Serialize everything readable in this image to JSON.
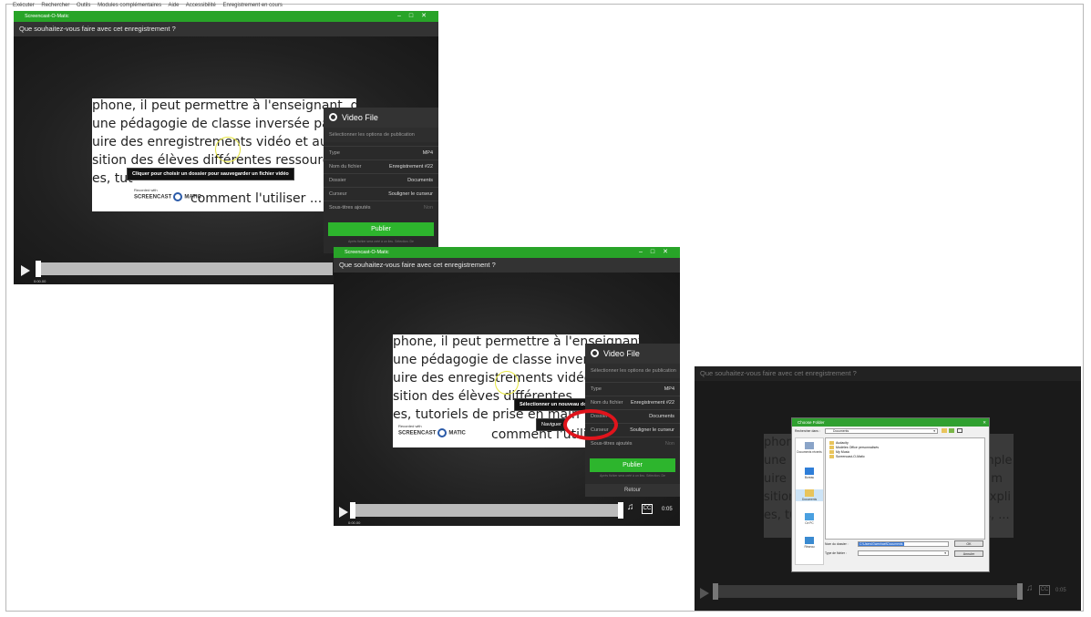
{
  "menubar": [
    "Exécuter",
    "Rechercher",
    "Outils",
    "Modules complémentaires",
    "Aide",
    "Accessibilité",
    "Enregistrement en cours"
  ],
  "window1": {
    "title": "Screencast-O-Matic",
    "question": "Que souhaitez-vous faire avec cet enregistrement ?",
    "slide_lines": [
      "phone, il peut permettre à l'enseignant, dans",
      "une pédagogie de classe inversée par ex",
      "uire des enregistrements vidéo et audi",
      "sition des élèves différentes ressources",
      "es, tut",
      "comment l'utiliser ..."
    ],
    "logo_top": "Recorded with",
    "logo": "SCREENCAST",
    "logo_tail": "MATIC",
    "tooltip": "Cliquer pour choisir un dossier pour sauvegarder un fichier vidéo",
    "panel": {
      "header": "Video File",
      "subtitle": "Sélectionner les options de publication",
      "rows": [
        {
          "label": "Type",
          "value": "MP4"
        },
        {
          "label": "Nom du fichier",
          "value": "Enregistrement #22"
        },
        {
          "label": "Dossier",
          "value": "Documents"
        },
        {
          "label": "Curseur",
          "value": "Souligner le curseur"
        },
        {
          "label": "Sous-titres ajoutés",
          "value": "Non"
        }
      ],
      "publish": "Publier",
      "fine": "Après fichier sera créé à un lieu. Sélection. De"
    },
    "time": "0:00.00"
  },
  "window2": {
    "title": "Screencast-O-Matic",
    "question": "Que souhaitez-vous faire avec cet enregistrement ?",
    "slide_lines": [
      "phone, il peut permettre à l'enseignant, dans",
      "une pédagogie de classe inversée par ex",
      "uire des enregistrements vidéo et audi",
      "sition des élèves différentes",
      "es, tutoriels de prise en main",
      "comment l'utilis"
    ],
    "logo_top": "Recorded with",
    "logo": "SCREENCAST",
    "logo_tail": "MATIC",
    "tooltip": "Sélectionner un nouveau dossier",
    "menu_item": "Naviguer",
    "panel": {
      "header": "Video File",
      "subtitle": "Sélectionner les options de publication",
      "rows": [
        {
          "label": "Type",
          "value": "MP4"
        },
        {
          "label": "Nom du fichier",
          "value": "Enregistrement #22"
        },
        {
          "label": "Dossier",
          "value": "Documents"
        },
        {
          "label": "Curseur",
          "value": "Souligner le curseur"
        },
        {
          "label": "Sous-titres ajoutés",
          "value": "Non"
        }
      ],
      "publish": "Publier",
      "fine": "Après fichier sera créé à un lieu. Sélection. De",
      "back": "Retour"
    },
    "cc": "CC",
    "duration": "0:05",
    "time": "0:00.00"
  },
  "window3": {
    "question": "Que souhaitez-vous faire avec cet enregistrement ?",
    "slide_lines": [
      "phone",
      "une",
      "uire",
      "sition",
      "es, tu"
    ],
    "slide_lines_right": [
      "n",
      "mple",
      "t m",
      "expli",
      "ns, ..."
    ],
    "dialog": {
      "title": "Choose Folder",
      "look_in_label": "Rechercher dans :",
      "look_in_value": "Documents",
      "places": [
        "Documents récents",
        "Bureau",
        "Documents",
        "Ce PC",
        "Réseau"
      ],
      "files": [
        "Audacity",
        "Modèles Office personnalisés",
        "My Music",
        "Screencast-O-Matic"
      ],
      "folder_label": "Nom du dossier :",
      "folder_value": "C:\\Users\\Gwenhael\\Documents",
      "type_label": "Type de fichier :",
      "ok": "OK",
      "cancel": "Annuler"
    },
    "cc": "CC",
    "duration": "0:05"
  }
}
